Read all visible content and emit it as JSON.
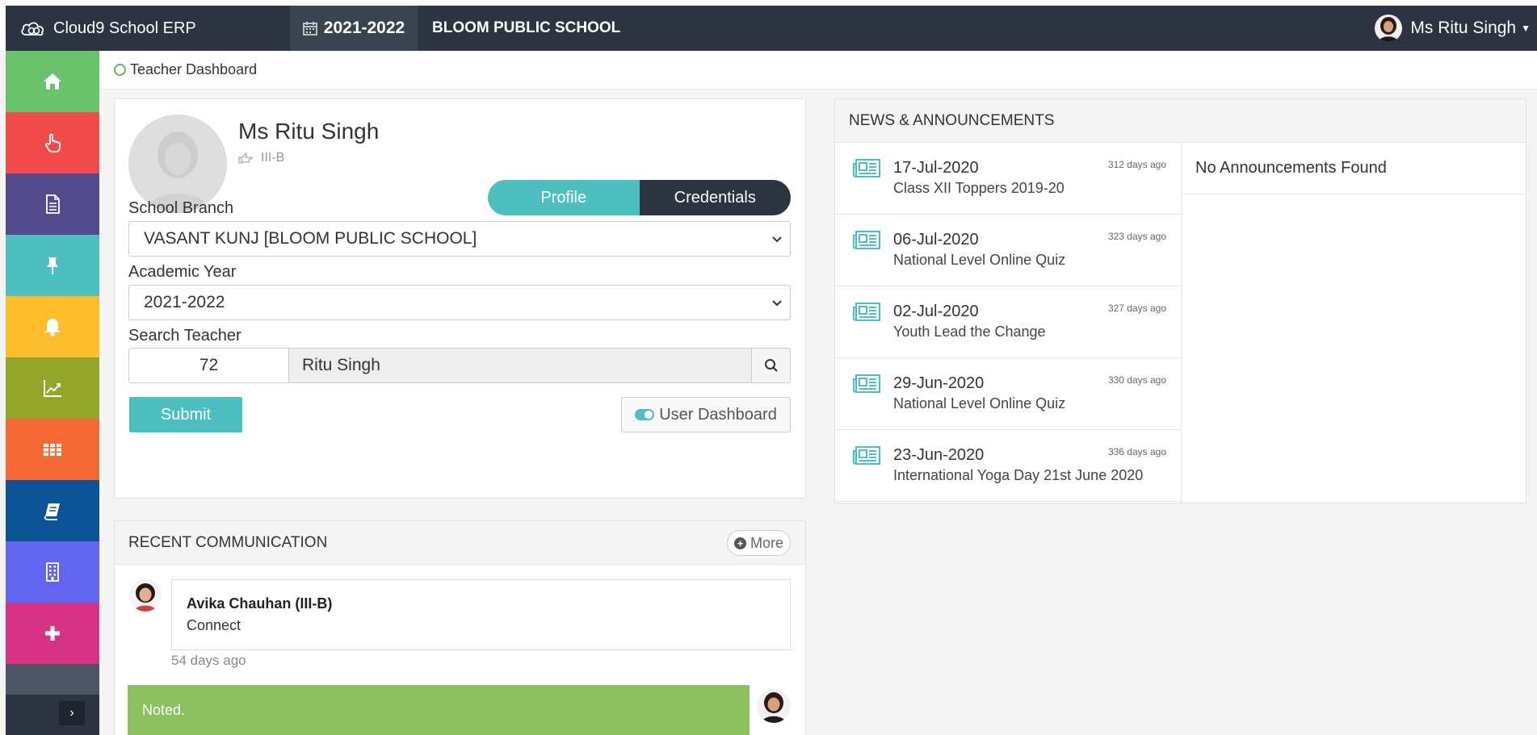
{
  "app": {
    "brand": "Cloud9 School ERP",
    "academic_year": "2021-2022",
    "school_name": "BLOOM PUBLIC SCHOOL"
  },
  "user": {
    "name": "Ms Ritu Singh"
  },
  "sidebar": {
    "items": [
      {
        "icon": "home-icon",
        "color": "#6ac26b"
      },
      {
        "icon": "hand-pointer-icon",
        "color": "#f24b4b"
      },
      {
        "icon": "document-icon",
        "color": "#534b8c"
      },
      {
        "icon": "pin-icon",
        "color": "#4dbfc0"
      },
      {
        "icon": "bell-icon",
        "color": "#fcbd2c"
      },
      {
        "icon": "chart-line-icon",
        "color": "#94a62a"
      },
      {
        "icon": "grid-icon",
        "color": "#f56a34"
      },
      {
        "icon": "book-icon",
        "color": "#0b5394"
      },
      {
        "icon": "building-icon",
        "color": "#6366f1"
      },
      {
        "icon": "plus-icon",
        "color": "#d63384"
      }
    ]
  },
  "breadcrumb": {
    "label": "Teacher Dashboard"
  },
  "profile": {
    "name": "Ms Ritu Singh",
    "class": "III-B",
    "tabs": {
      "profile": "Profile",
      "credentials": "Credentials"
    },
    "branch_label": "School Branch",
    "branch_value": "VASANT KUNJ [BLOOM PUBLIC SCHOOL]",
    "year_label": "Academic Year",
    "year_value": "2021-2022",
    "search_label": "Search Teacher",
    "search_id": "72",
    "search_name": "Ritu Singh",
    "submit": "Submit",
    "user_dashboard": "User Dashboard"
  },
  "communication": {
    "title": "RECENT COMMUNICATION",
    "more": "More",
    "message": {
      "sender": "Avika Chauhan (III-B)",
      "text": "Connect",
      "time": "54 days ago"
    },
    "reply": {
      "text": "Noted."
    }
  },
  "news": {
    "title": "NEWS & ANNOUNCEMENTS",
    "items": [
      {
        "date": "17-Jul-2020",
        "title": "Class XII Toppers 2019-20",
        "ago": "312 days ago"
      },
      {
        "date": "06-Jul-2020",
        "title": "National Level Online Quiz",
        "ago": "323 days ago"
      },
      {
        "date": "02-Jul-2020",
        "title": "Youth Lead the Change",
        "ago": "327 days ago"
      },
      {
        "date": "29-Jun-2020",
        "title": "National Level Online Quiz",
        "ago": "330 days ago"
      },
      {
        "date": "23-Jun-2020",
        "title": "International Yoga Day 21st June 2020",
        "ago": "336 days ago"
      }
    ],
    "empty_announcements": "No Announcements Found"
  },
  "colors": {
    "teal": "#4dbfc0",
    "navy": "#2b3440",
    "green_bubble": "#8cbf5f"
  }
}
